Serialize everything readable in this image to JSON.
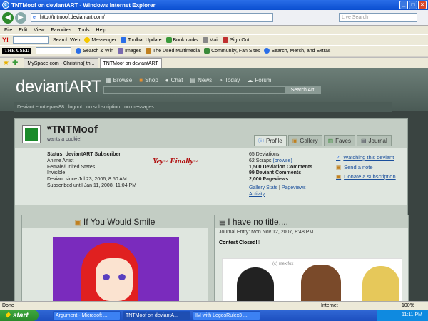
{
  "window": {
    "title": "TNTMoof on deviantART - Windows Internet Explorer"
  },
  "address": {
    "url": "http://tntmoof.deviantart.com/",
    "search_placeholder": "Live Search"
  },
  "menu": [
    "File",
    "Edit",
    "View",
    "Favorites",
    "Tools",
    "Help"
  ],
  "toolbar1": {
    "search_web": "Search Web",
    "messenger": "Messenger",
    "toolbar_update": "Toolbar Update",
    "bookmarks": "Bookmarks",
    "mail": "Mail",
    "sign_out": "Sign Out"
  },
  "toolbar2": {
    "logo": "THE USED",
    "search_win": "Search & Win",
    "images": "Images",
    "used_multimedia": "The Used Multimedia",
    "community": "Community, Fan Sites",
    "merch": "Search, Merch, and Extras"
  },
  "tabs": [
    "MySpace.com - Christina( th...",
    "TNTMoof on deviantART"
  ],
  "da": {
    "logo": "deviantART",
    "nav": [
      "Browse",
      "Shop",
      "Chat",
      "News",
      "Today",
      "Forum"
    ],
    "search_button": "Search Art",
    "userbar": {
      "user": "Deviant ~turtlepaw88",
      "logout": "logout",
      "subscription": "no subscription",
      "messages": "no messages"
    }
  },
  "profile": {
    "name": "*TNTMoof",
    "tagline": "wants a cookie!",
    "tabs": [
      "Profile",
      "Gallery",
      "Faves",
      "Journal"
    ],
    "status_label": "Status: deviantART Subscriber",
    "lines": [
      "Anime Artist",
      "Female/United States",
      "Invisible",
      "Deviant since Jul 23, 2006, 8:50 AM",
      "Subscribed until Jan 11, 2008, 11:04 PM"
    ],
    "yey": "Yey~ Finally~",
    "stats": {
      "deviations": "65 Deviations",
      "scraps": "62 Scraps",
      "browse": "(browse)",
      "dev_comments": "1,500 Deviation Comments",
      "deviant_comments": "99 Deviant Comments",
      "pageviews": "2,000 Pageviews",
      "gallery_stats": "Gallery Stats",
      "sep": "|",
      "pageviews_link": "Pageviews",
      "activity": "Activity"
    },
    "actions": [
      "Watching this deviant",
      "Send a note",
      "Donate a subscription"
    ]
  },
  "left_panel": {
    "title": "If You Would Smile"
  },
  "right_panel": {
    "title": "I have no title....",
    "entry": "Journal Entry: Mon Nov 12, 2007, 8:48 PM",
    "contest": "Contest Closed!!!",
    "img_text": "(c) mexifox"
  },
  "status": {
    "left": "Done",
    "zone": "Internet",
    "zoom": "100%"
  },
  "taskbar": {
    "start": "start",
    "tasks": [
      "Argument - Microsoft ...",
      "TNTMoof on deviantA...",
      "IM with LegosRulex3 ..."
    ],
    "time": "11:11 PM"
  }
}
